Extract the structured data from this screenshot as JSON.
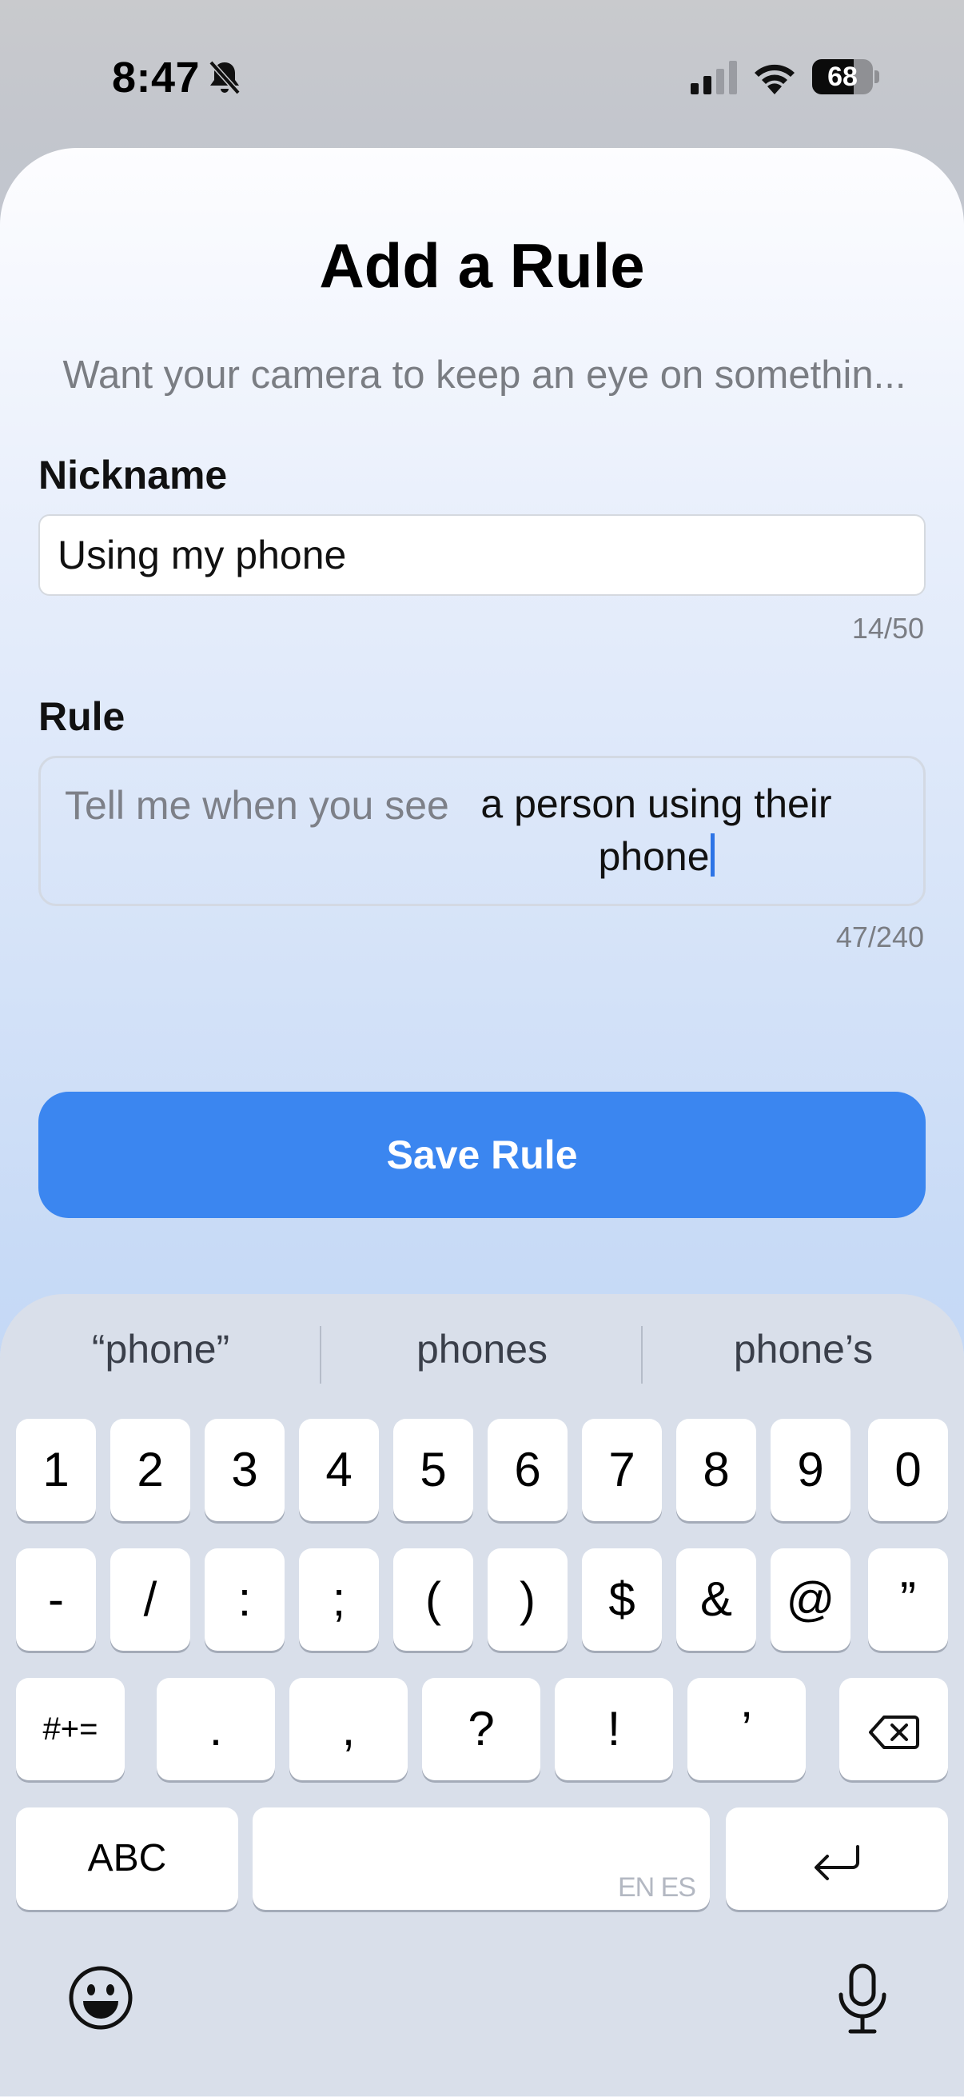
{
  "status_bar": {
    "time": "8:47",
    "battery_level": "68",
    "icons": [
      "bell-slash-icon",
      "cellular-signal-icon",
      "wifi-icon",
      "battery-icon"
    ]
  },
  "sheet": {
    "title": "Add a Rule",
    "subtitle": "Want your camera to keep an eye on somethin...",
    "nickname": {
      "label": "Nickname",
      "value": "Using my phone",
      "counter": "14/50"
    },
    "rule": {
      "label": "Rule",
      "prefix": "Tell me when you see",
      "value": "a person using their phone",
      "counter": "47/240"
    },
    "save_button": "Save Rule",
    "accent_color": "#3b86f0"
  },
  "keyboard": {
    "suggestions": [
      "“phone”",
      "phones",
      "phone’s"
    ],
    "row1": [
      "1",
      "2",
      "3",
      "4",
      "5",
      "6",
      "7",
      "8",
      "9",
      "0"
    ],
    "row2": [
      "-",
      "/",
      ":",
      ";",
      "(",
      ")",
      "$",
      "&",
      "@",
      "”"
    ],
    "row3": [
      "#+=",
      ".",
      ",",
      "?",
      "!",
      "’"
    ],
    "row4": {
      "abc": "ABC",
      "space_hint": "EN ES"
    },
    "icons": [
      "delete-icon",
      "return-icon",
      "emoji-icon",
      "microphone-icon"
    ]
  }
}
